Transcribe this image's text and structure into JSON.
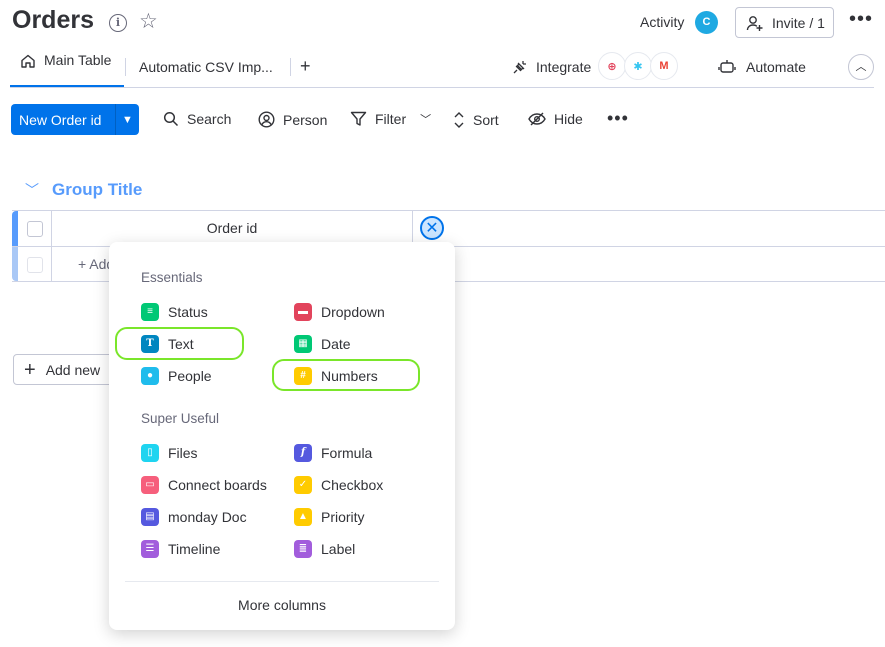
{
  "header": {
    "title": "Orders",
    "activity_label": "Activity",
    "avatar_initial": "C",
    "invite_label": "Invite / 1",
    "more_label": "•••"
  },
  "tabs": {
    "main_table": "Main Table",
    "csv_import": "Automatic CSV Imp...",
    "add_tab": "+",
    "integrate": "Integrate",
    "automate": "Automate"
  },
  "toolbar": {
    "new_item": "New Order id",
    "search": "Search",
    "person": "Person",
    "filter": "Filter",
    "sort": "Sort",
    "hide": "Hide",
    "more": "•••"
  },
  "group": {
    "title": "Group Title",
    "column_header": "Order id",
    "add_item": "+ Add",
    "add_new_group": "Add new"
  },
  "column_menu": {
    "essentials_label": "Essentials",
    "super_useful_label": "Super Useful",
    "essentials": [
      {
        "label": "Status",
        "color": "#00c875"
      },
      {
        "label": "Dropdown",
        "color": "#e2445c"
      },
      {
        "label": "Text",
        "color": "#0086c0"
      },
      {
        "label": "Date",
        "color": "#00c875"
      },
      {
        "label": "People",
        "color": "#1fbcec"
      },
      {
        "label": "Numbers",
        "color": "#ffcb00"
      }
    ],
    "super_useful": [
      {
        "label": "Files",
        "color": "#1fd4f0"
      },
      {
        "label": "Formula",
        "color": "#5559df"
      },
      {
        "label": "Connect boards",
        "color": "#f65f7c"
      },
      {
        "label": "Checkbox",
        "color": "#ffcb00"
      },
      {
        "label": "monday Doc",
        "color": "#5559df"
      },
      {
        "label": "Priority",
        "color": "#ffcb00"
      },
      {
        "label": "Timeline",
        "color": "#a25ddc"
      },
      {
        "label": "Label",
        "color": "#a25ddc"
      }
    ],
    "more_columns": "More columns"
  },
  "colors": {
    "primary": "#0073ea",
    "group_accent": "#579bfc",
    "highlight": "#7ae62a"
  }
}
